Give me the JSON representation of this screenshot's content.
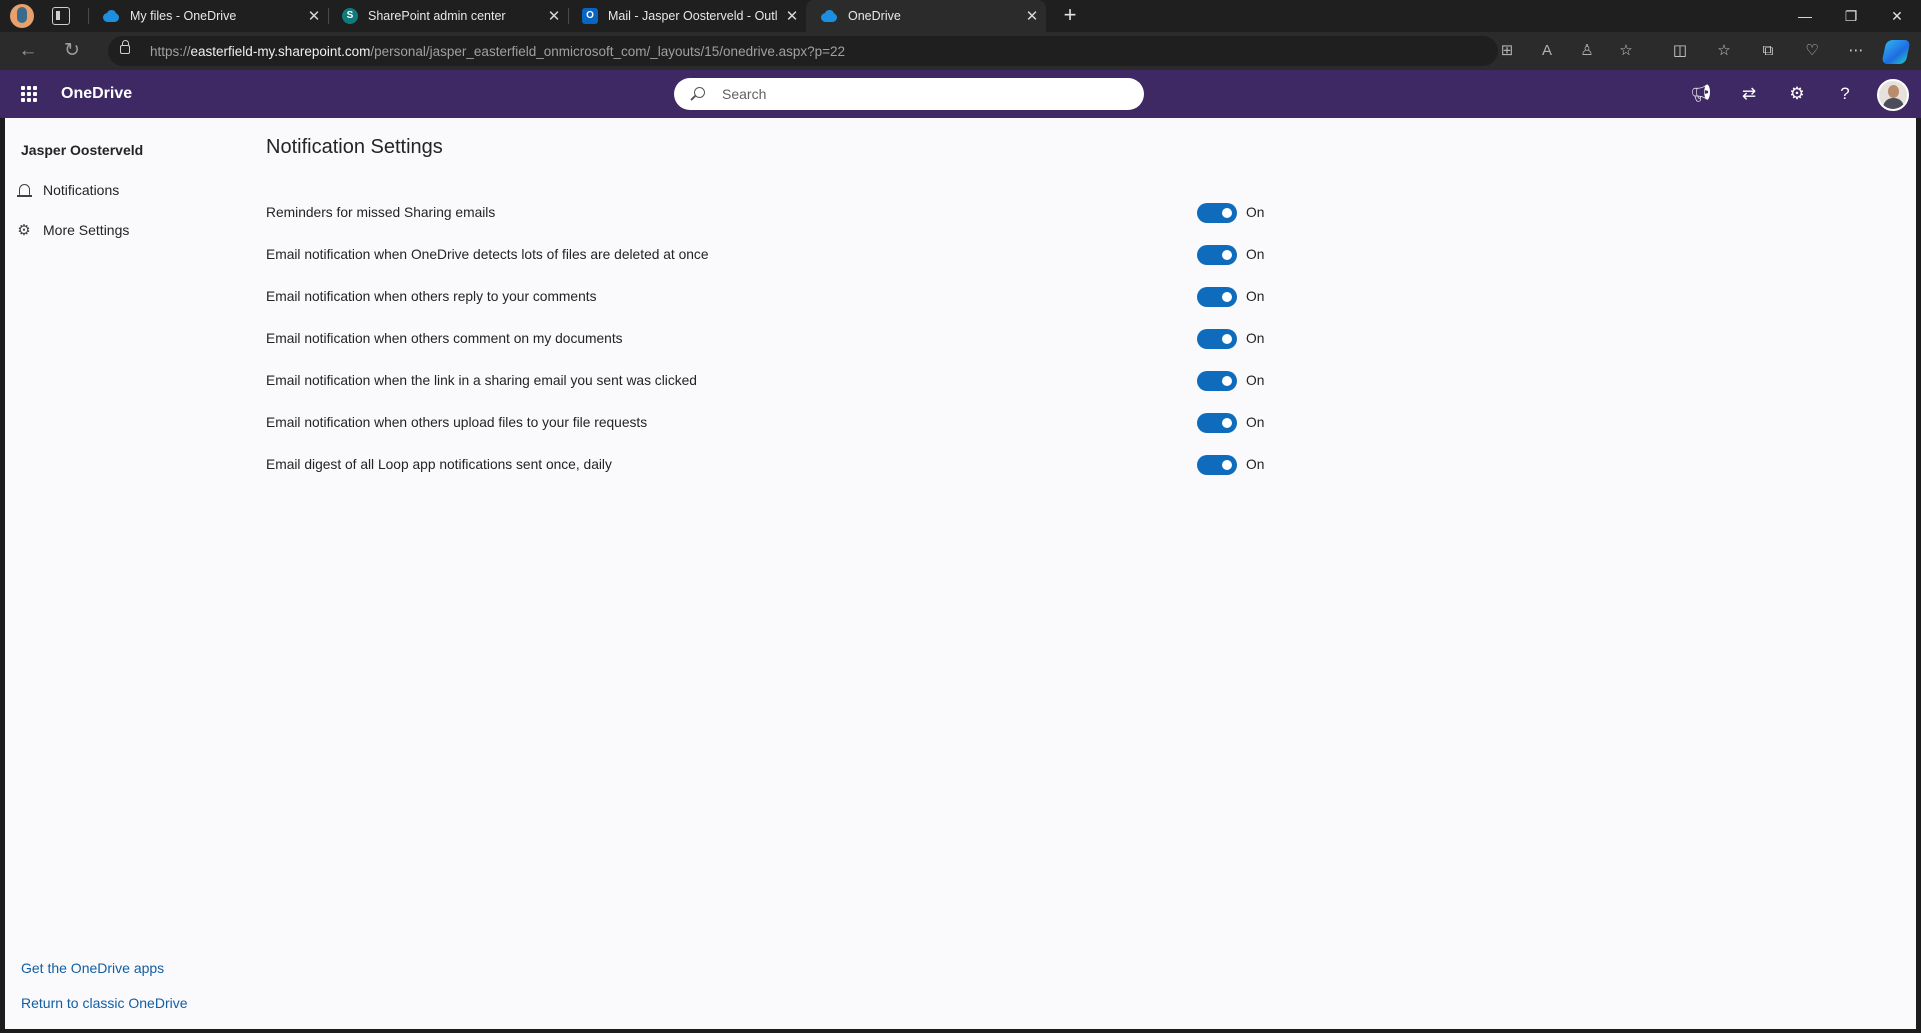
{
  "browser": {
    "tabs": [
      {
        "title": "My files - OneDrive",
        "icon": "onedrive-icon"
      },
      {
        "title": "SharePoint admin center",
        "icon": "sharepoint-icon"
      },
      {
        "title": "Mail - Jasper Oosterveld - Outlook",
        "icon": "outlook-icon"
      },
      {
        "title": "OneDrive",
        "icon": "onedrive-icon"
      }
    ],
    "active_tab_index": 3,
    "address": {
      "scheme": "https://",
      "host": "easterfield-my.sharepoint.com",
      "path": "/personal/jasper_easterfield_onmicrosoft_com/_layouts/15/onedrive.aspx?p=22"
    }
  },
  "app": {
    "name": "OneDrive",
    "search_placeholder": "Search",
    "header_color": "#3e2965"
  },
  "sidebar": {
    "user_name": "Jasper Oosterveld",
    "items": [
      {
        "label": "Notifications",
        "icon": "bell-icon"
      },
      {
        "label": "More Settings",
        "icon": "gear-icon"
      }
    ],
    "footer_links": [
      {
        "label": "Get the OneDrive apps"
      },
      {
        "label": "Return to classic OneDrive"
      }
    ]
  },
  "main": {
    "title": "Notification Settings",
    "settings": [
      {
        "label": "Reminders for missed Sharing emails",
        "enabled": true,
        "state_label": "On"
      },
      {
        "label": "Email notification when OneDrive detects lots of files are deleted at once",
        "enabled": true,
        "state_label": "On"
      },
      {
        "label": "Email notification when others reply to your comments",
        "enabled": true,
        "state_label": "On"
      },
      {
        "label": "Email notification when others comment on my documents",
        "enabled": true,
        "state_label": "On"
      },
      {
        "label": "Email notification when the link in a sharing email you sent was clicked",
        "enabled": true,
        "state_label": "On"
      },
      {
        "label": "Email notification when others upload files to your file requests",
        "enabled": true,
        "state_label": "On"
      },
      {
        "label": "Email digest of all Loop app notifications sent once, daily",
        "enabled": true,
        "state_label": "On"
      }
    ],
    "toggle_color": "#0f6cbd"
  }
}
